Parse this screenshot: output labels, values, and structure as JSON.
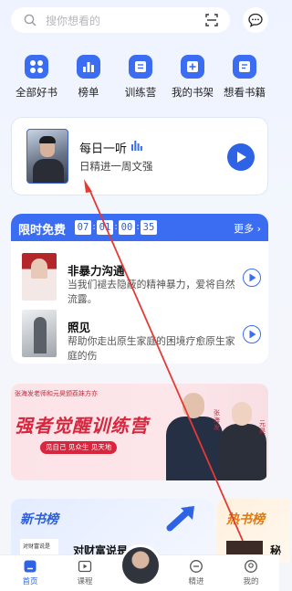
{
  "search": {
    "placeholder": "搜你想看的"
  },
  "shortcuts": [
    {
      "label": "全部好书",
      "icon": "grid-icon"
    },
    {
      "label": "榜单",
      "icon": "ranking-icon"
    },
    {
      "label": "训练营",
      "icon": "training-camp-icon"
    },
    {
      "label": "我的书架",
      "icon": "add-bookshelf-icon"
    },
    {
      "label": "想看书籍",
      "icon": "wishlist-book-icon"
    }
  ],
  "daily": {
    "title": "每日一听",
    "subtitle": "日精进一周文强"
  },
  "free": {
    "title": "限时免费",
    "timer": [
      "07",
      "01",
      "00",
      "35"
    ],
    "more": "更多",
    "books": [
      {
        "title": "非暴力沟通",
        "desc": "当我们褪去隐蔽的精神暴力，爱将自然流露。"
      },
      {
        "title": "照见",
        "desc": "帮助你走出原生家庭的困境疗愈原生家庭的伤"
      }
    ]
  },
  "banner": {
    "top_text": "张海发老师和元昊颁荔妹方亦",
    "title": "强者觉醒训练营",
    "pill": "见自己 见众生 见天地",
    "name1": "张海发",
    "name2": "元昊"
  },
  "rank": {
    "new_title": "新书榜",
    "new_book": "对财富说是",
    "new_cover_text": "对财富说是",
    "hot_title": "热书榜",
    "hot_book": "秘"
  },
  "tabbar": [
    {
      "label": "首页",
      "icon": "home-icon",
      "active": true
    },
    {
      "label": "课程",
      "icon": "course-icon",
      "active": false
    },
    {
      "label": "精进",
      "icon": "progress-icon",
      "active": false
    },
    {
      "label": "我的",
      "icon": "profile-icon",
      "active": false
    }
  ],
  "colors": {
    "accent": "#2f63e6",
    "annotation": "#e53935",
    "banner_red": "#d7263d",
    "hot_orange": "#e07a12"
  }
}
